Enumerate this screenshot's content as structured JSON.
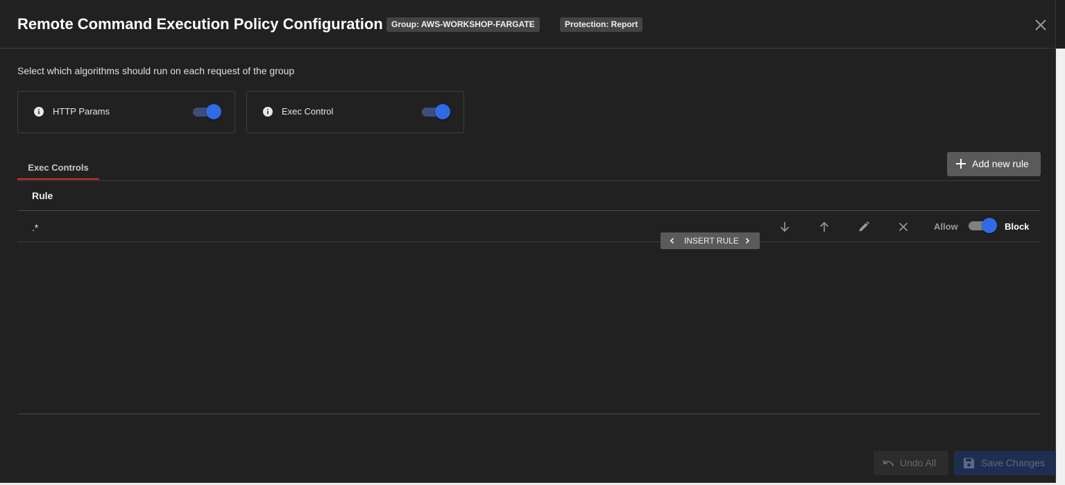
{
  "dialog": {
    "title": "Remote Command Execution Policy Configuration",
    "group_chip": "Group: AWS-WORKSHOP-FARGATE",
    "protection_chip": "Protection: Report",
    "close_icon": "close-icon"
  },
  "subtitle": "Select which algorithms should run on each request of the group",
  "algorithms": [
    {
      "label": "HTTP Params",
      "enabled": true,
      "icon": "info-icon"
    },
    {
      "label": "Exec Control",
      "enabled": true,
      "icon": "info-icon"
    }
  ],
  "tabs": [
    {
      "label": "Exec Controls",
      "active": true
    }
  ],
  "add_rule_label": "Add new rule",
  "table": {
    "column_rule": "Rule",
    "rows": [
      {
        "rule": ".*",
        "allow_label": "Allow",
        "block_label": "Block",
        "mode": "Block"
      }
    ]
  },
  "insert_rule_label": "INSERT RULE",
  "footer": {
    "undo_label": "Undo All",
    "save_label": "Save Changes"
  },
  "colors": {
    "accent": "#2f6be6",
    "tab_underline": "#d0362b",
    "background": "#212121"
  }
}
